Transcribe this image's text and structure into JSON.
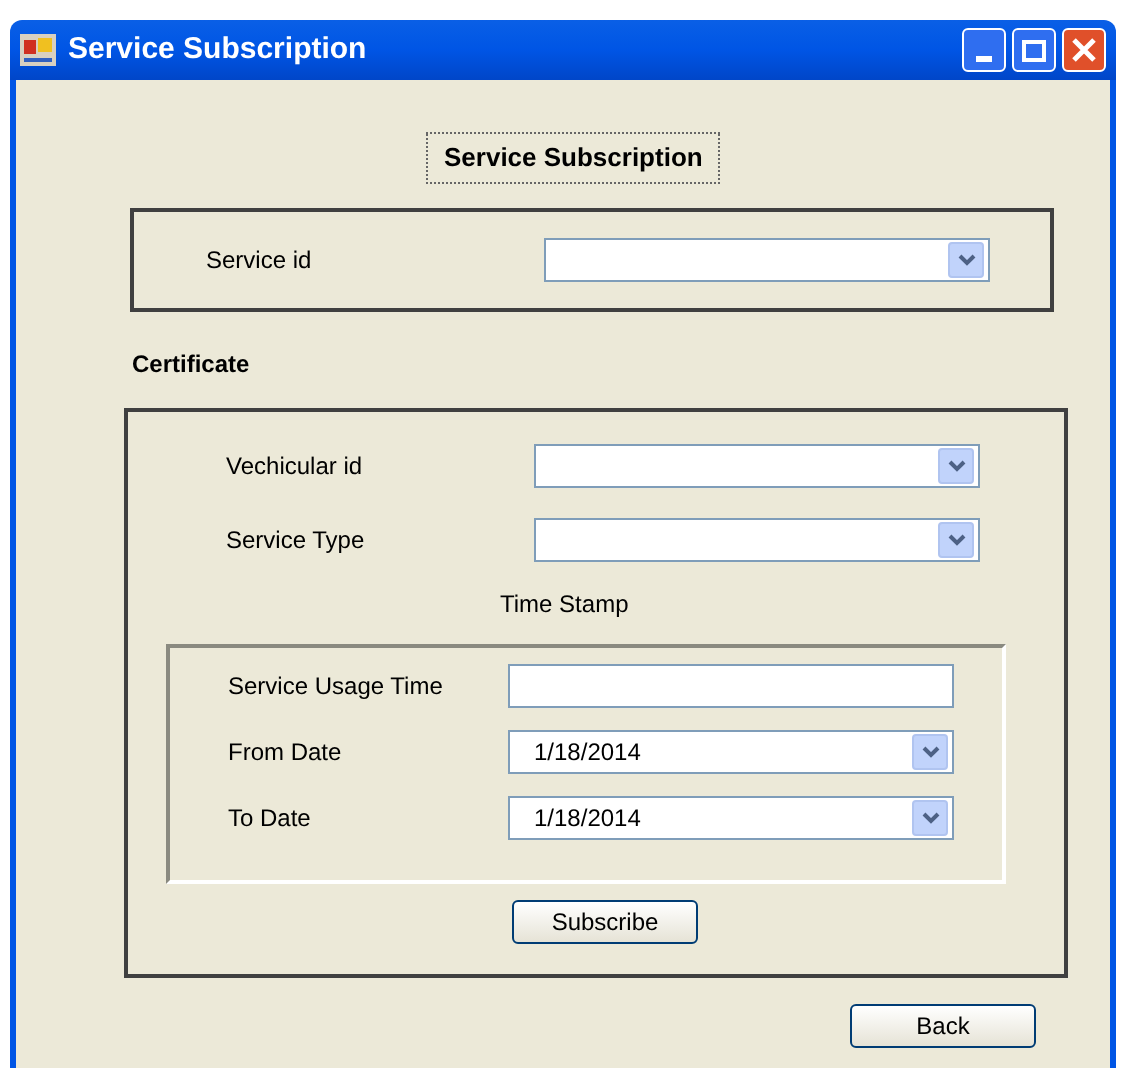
{
  "window": {
    "title": "Service Subscription"
  },
  "heading": "Service Subscription",
  "service_panel": {
    "label": "Service id"
  },
  "certificate": {
    "title": "Certificate",
    "fields": [
      {
        "label": "Vechicular id",
        "kind": "combo"
      },
      {
        "label": "Service Type",
        "kind": "combo"
      }
    ],
    "time_stamp": {
      "title": "Time Stamp",
      "fields": [
        {
          "label": "Service Usage Time",
          "kind": "text"
        },
        {
          "label": "From Date",
          "kind": "date",
          "value": "1/18/2014"
        },
        {
          "label": "To Date",
          "kind": "date",
          "value": "1/18/2014"
        }
      ]
    },
    "button": "Subscribe"
  },
  "back_button": "Back"
}
